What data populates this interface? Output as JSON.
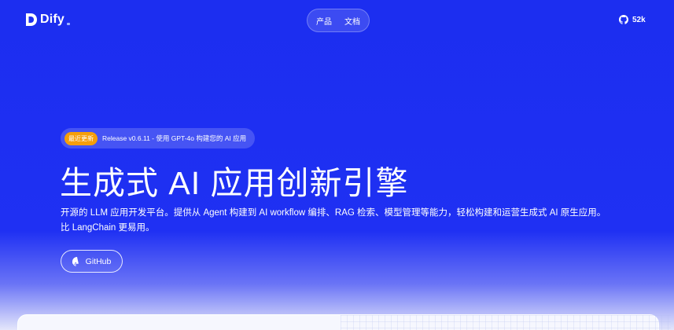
{
  "header": {
    "logo_text": "Dify",
    "nav": [
      "产品",
      "文档"
    ],
    "github_stars": "52k"
  },
  "hero": {
    "badge_tag": "最近更新",
    "badge_text": "Release v0.6.11 - 使用 GPT-4o 构建您的 AI 应用",
    "title": "生成式 AI 应用创新引擎",
    "description_line1": "开源的 LLM 应用开发平台。提供从 Agent 构建到 AI workflow 编排、RAG 检索、模型管理等能力，轻松构建和运营生成式 AI 原生应用。",
    "description_line2": "比 LangChain 更易用。",
    "github_button": "GitHub"
  },
  "colors": {
    "background": "#1c2ef0",
    "badge_tag": "#f59e0b"
  }
}
